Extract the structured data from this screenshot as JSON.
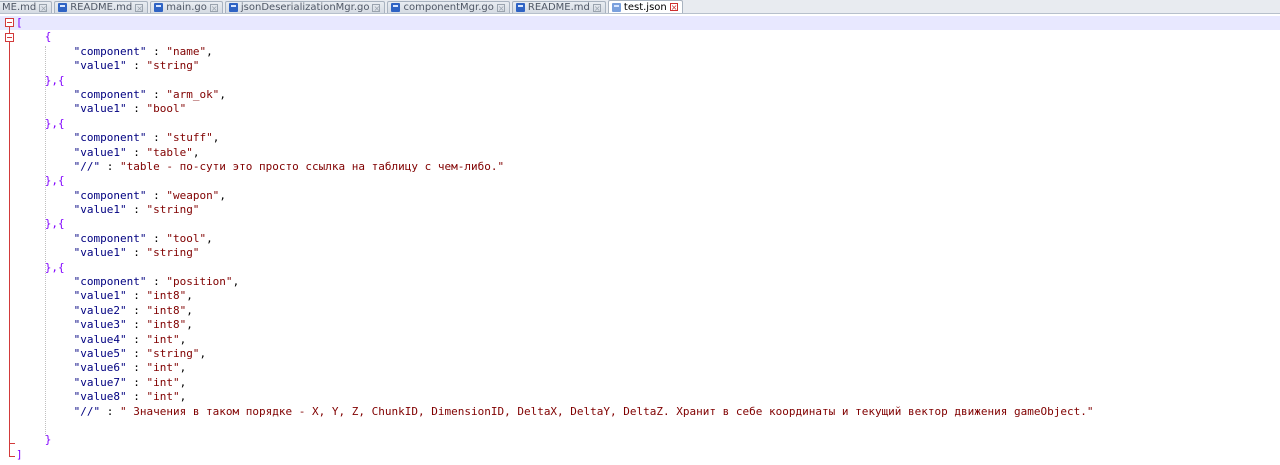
{
  "tabs": [
    {
      "label": "ME.md"
    },
    {
      "label": "README.md"
    },
    {
      "label": "main.go"
    },
    {
      "label": "jsonDeserializationMgr.go"
    },
    {
      "label": "componentMgr.go"
    },
    {
      "label": "README.md"
    },
    {
      "label": "test.json",
      "active": true
    }
  ],
  "lines": [
    {
      "indent": 0,
      "tokens": [
        {
          "t": "[",
          "c": "p"
        }
      ]
    },
    {
      "indent": 4,
      "tokens": [
        {
          "t": "{",
          "c": "p"
        }
      ]
    },
    {
      "indent": 8,
      "tokens": [
        {
          "t": "\"component\"",
          "c": "k"
        },
        {
          "t": " : ",
          "c": "o"
        },
        {
          "t": "\"name\"",
          "c": "s"
        },
        {
          "t": ",",
          "c": "o"
        }
      ]
    },
    {
      "indent": 8,
      "tokens": [
        {
          "t": "\"value1\"",
          "c": "k"
        },
        {
          "t": " : ",
          "c": "o"
        },
        {
          "t": "\"string\"",
          "c": "s"
        }
      ]
    },
    {
      "indent": 4,
      "tokens": [
        {
          "t": "},{",
          "c": "p"
        }
      ]
    },
    {
      "indent": 8,
      "tokens": [
        {
          "t": "\"component\"",
          "c": "k"
        },
        {
          "t": " : ",
          "c": "o"
        },
        {
          "t": "\"arm_ok\"",
          "c": "s"
        },
        {
          "t": ",",
          "c": "o"
        }
      ]
    },
    {
      "indent": 8,
      "tokens": [
        {
          "t": "\"value1\"",
          "c": "k"
        },
        {
          "t": " : ",
          "c": "o"
        },
        {
          "t": "\"bool\"",
          "c": "s"
        }
      ]
    },
    {
      "indent": 4,
      "tokens": [
        {
          "t": "},{",
          "c": "p"
        }
      ]
    },
    {
      "indent": 8,
      "tokens": [
        {
          "t": "\"component\"",
          "c": "k"
        },
        {
          "t": " : ",
          "c": "o"
        },
        {
          "t": "\"stuff\"",
          "c": "s"
        },
        {
          "t": ",",
          "c": "o"
        }
      ]
    },
    {
      "indent": 8,
      "tokens": [
        {
          "t": "\"value1\"",
          "c": "k"
        },
        {
          "t": " : ",
          "c": "o"
        },
        {
          "t": "\"table\"",
          "c": "s"
        },
        {
          "t": ",",
          "c": "o"
        }
      ]
    },
    {
      "indent": 8,
      "tokens": [
        {
          "t": "\"//\"",
          "c": "k"
        },
        {
          "t": " : ",
          "c": "o"
        },
        {
          "t": "\"table - по-сути это просто ссылка на таблицу с чем-либо.\"",
          "c": "s"
        }
      ]
    },
    {
      "indent": 4,
      "tokens": [
        {
          "t": "},{",
          "c": "p"
        }
      ]
    },
    {
      "indent": 8,
      "tokens": [
        {
          "t": "\"component\"",
          "c": "k"
        },
        {
          "t": " : ",
          "c": "o"
        },
        {
          "t": "\"weapon\"",
          "c": "s"
        },
        {
          "t": ",",
          "c": "o"
        }
      ]
    },
    {
      "indent": 8,
      "tokens": [
        {
          "t": "\"value1\"",
          "c": "k"
        },
        {
          "t": " : ",
          "c": "o"
        },
        {
          "t": "\"string\"",
          "c": "s"
        }
      ]
    },
    {
      "indent": 4,
      "tokens": [
        {
          "t": "},{",
          "c": "p"
        }
      ]
    },
    {
      "indent": 8,
      "tokens": [
        {
          "t": "\"component\"",
          "c": "k"
        },
        {
          "t": " : ",
          "c": "o"
        },
        {
          "t": "\"tool\"",
          "c": "s"
        },
        {
          "t": ",",
          "c": "o"
        }
      ]
    },
    {
      "indent": 8,
      "tokens": [
        {
          "t": "\"value1\"",
          "c": "k"
        },
        {
          "t": " : ",
          "c": "o"
        },
        {
          "t": "\"string\"",
          "c": "s"
        }
      ]
    },
    {
      "indent": 4,
      "tokens": [
        {
          "t": "},{",
          "c": "p"
        }
      ]
    },
    {
      "indent": 8,
      "tokens": [
        {
          "t": "\"component\"",
          "c": "k"
        },
        {
          "t": " : ",
          "c": "o"
        },
        {
          "t": "\"position\"",
          "c": "s"
        },
        {
          "t": ",",
          "c": "o"
        }
      ]
    },
    {
      "indent": 8,
      "tokens": [
        {
          "t": "\"value1\"",
          "c": "k"
        },
        {
          "t": " : ",
          "c": "o"
        },
        {
          "t": "\"int8\"",
          "c": "s"
        },
        {
          "t": ",",
          "c": "o"
        }
      ]
    },
    {
      "indent": 8,
      "tokens": [
        {
          "t": "\"value2\"",
          "c": "k"
        },
        {
          "t": " : ",
          "c": "o"
        },
        {
          "t": "\"int8\"",
          "c": "s"
        },
        {
          "t": ",",
          "c": "o"
        }
      ]
    },
    {
      "indent": 8,
      "tokens": [
        {
          "t": "\"value3\"",
          "c": "k"
        },
        {
          "t": " : ",
          "c": "o"
        },
        {
          "t": "\"int8\"",
          "c": "s"
        },
        {
          "t": ",",
          "c": "o"
        }
      ]
    },
    {
      "indent": 8,
      "tokens": [
        {
          "t": "\"value4\"",
          "c": "k"
        },
        {
          "t": " : ",
          "c": "o"
        },
        {
          "t": "\"int\"",
          "c": "s"
        },
        {
          "t": ",",
          "c": "o"
        }
      ]
    },
    {
      "indent": 8,
      "tokens": [
        {
          "t": "\"value5\"",
          "c": "k"
        },
        {
          "t": " : ",
          "c": "o"
        },
        {
          "t": "\"string\"",
          "c": "s"
        },
        {
          "t": ",",
          "c": "o"
        }
      ]
    },
    {
      "indent": 8,
      "tokens": [
        {
          "t": "\"value6\"",
          "c": "k"
        },
        {
          "t": " : ",
          "c": "o"
        },
        {
          "t": "\"int\"",
          "c": "s"
        },
        {
          "t": ",",
          "c": "o"
        }
      ]
    },
    {
      "indent": 8,
      "tokens": [
        {
          "t": "\"value7\"",
          "c": "k"
        },
        {
          "t": " : ",
          "c": "o"
        },
        {
          "t": "\"int\"",
          "c": "s"
        },
        {
          "t": ",",
          "c": "o"
        }
      ]
    },
    {
      "indent": 8,
      "tokens": [
        {
          "t": "\"value8\"",
          "c": "k"
        },
        {
          "t": " : ",
          "c": "o"
        },
        {
          "t": "\"int\"",
          "c": "s"
        },
        {
          "t": ",",
          "c": "o"
        }
      ]
    },
    {
      "indent": 8,
      "tokens": [
        {
          "t": "\"//\"",
          "c": "k"
        },
        {
          "t": " : ",
          "c": "o"
        },
        {
          "t": "\" Значения в таком порядке - X, Y, Z, ChunkID, DimensionID, DeltaX, DeltaY, DeltaZ. Хранит в себе координаты и текущий вектор движения gameObject.\"",
          "c": "s"
        }
      ]
    },
    {
      "indent": 0,
      "tokens": []
    },
    {
      "indent": 4,
      "tokens": [
        {
          "t": "}",
          "c": "p"
        }
      ]
    },
    {
      "indent": 0,
      "tokens": [
        {
          "t": "]",
          "c": "p"
        }
      ]
    }
  ],
  "colors": {
    "bracket": "#8000ff",
    "key": "#000080",
    "string": "#800000",
    "fold_marker": "#d23a3a",
    "current_line": "#e8e8ff"
  }
}
